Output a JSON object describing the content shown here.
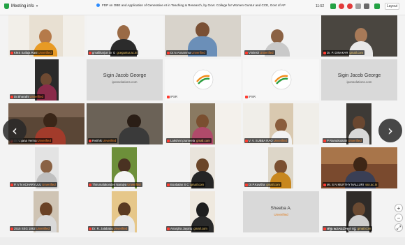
{
  "topbar": {
    "meeting_info": "Meeting info",
    "meeting_title": "FDP on OBE and Application of Generative AI in Teaching & Research, by Govt. College for Women Guntur and CCE, Govt of AP",
    "time": "11:52",
    "layout_label": "Layout"
  },
  "colors": {
    "unverified": "#ff8a2a",
    "domain": "#ffd36b",
    "accent": "#2d8cff"
  },
  "tiles": [
    {
      "name": "KMS Sailaja Rani",
      "status": "Unverified"
    },
    {
      "name": "gmallikarjun Dr G",
      "status": "",
      "domain": "gceguntur.ac.in"
    },
    {
      "name": "Dr.N.Annamma",
      "status": "Unverified"
    },
    {
      "name": "Vimlesh",
      "status": "Unverified"
    },
    {
      "name": "Dr. P. DINAKAR",
      "status": "",
      "domain": "gmail.com"
    },
    {
      "name": "Dr.Bharathi",
      "status": "Unverified"
    },
    {
      "name": "Sigin Jacob George",
      "subtitle": "iponsolutions.com",
      "status": ""
    },
    {
      "name": "IPSR",
      "status": ""
    },
    {
      "name": "IPSR",
      "status": ""
    },
    {
      "name": "Sigin Jacob George",
      "subtitle": "iponsolutions.com",
      "status": ""
    },
    {
      "name": "Dr Anjana Verma",
      "status": "Unverified"
    },
    {
      "name": "Rwithik",
      "status": "Unverified"
    },
    {
      "name": "Lakshmi prameela",
      "status": "",
      "domain": "gmail.com"
    },
    {
      "name": "V. V. SUBBA RAO",
      "status": "Unverified"
    },
    {
      "name": "P Ramakotaiah",
      "status": "Unverified"
    },
    {
      "name": "P. V N ACHARYULU",
      "status": "Unverified"
    },
    {
      "name": "Thirumalakonden Naraiya",
      "status": "Unverified"
    },
    {
      "name": "Boobalan S C",
      "status": "",
      "domain": "gmail.com"
    },
    {
      "name": "Dr.P.Kavitha",
      "status": "",
      "domain": "gmail.com"
    },
    {
      "name": "Mr. S N MURTHY NALLURI",
      "status": "",
      "domain": "ssn.ac.in"
    },
    {
      "name": "2515 SEG 1862",
      "status": "Unverified"
    },
    {
      "name": "Dr. R. Jalababu",
      "status": "Unverified"
    },
    {
      "name": "Anargha Jayaraj",
      "status": "",
      "domain": "gmail.com"
    },
    {
      "name": "Sheeba A.",
      "subtitle": "Unverified",
      "status": ""
    },
    {
      "name": "తొత్తు ఉమామహేశ్వర రెడ్డి",
      "status": "",
      "domain": "gmail.com"
    }
  ]
}
